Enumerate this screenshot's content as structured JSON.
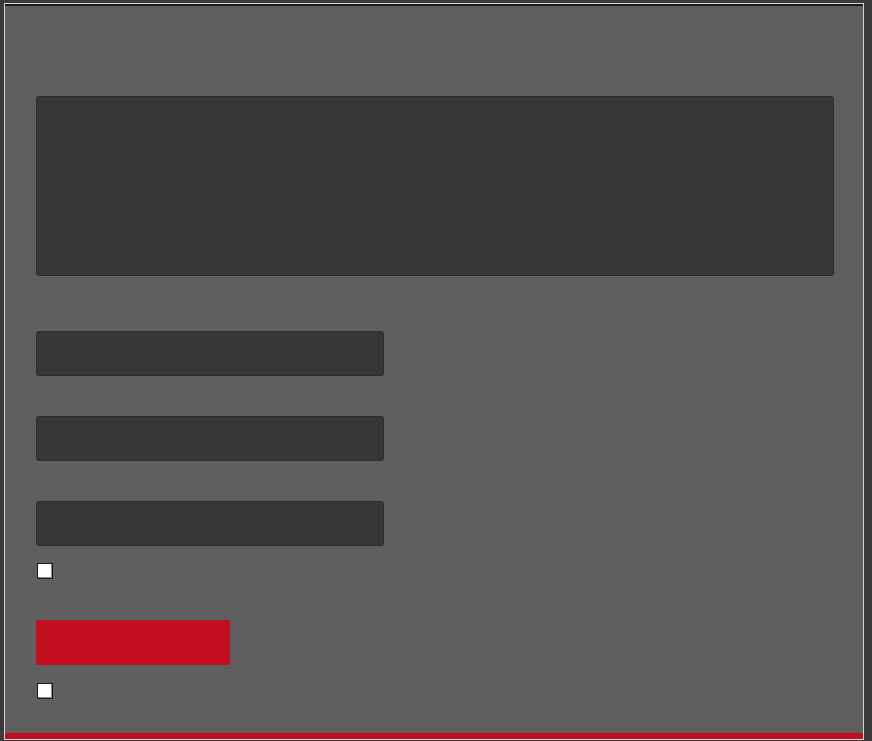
{
  "form": {
    "message": {
      "value": "",
      "placeholder": ""
    },
    "fields": [
      {
        "value": "",
        "placeholder": ""
      },
      {
        "value": "",
        "placeholder": ""
      },
      {
        "value": "",
        "placeholder": ""
      }
    ],
    "checkboxes": [
      {
        "label": "",
        "checked": false
      },
      {
        "label": "",
        "checked": false
      }
    ],
    "submit_label": ""
  },
  "colors": {
    "background": "#5f5f5f",
    "field_background": "#373737",
    "accent": "#c20e1f"
  }
}
